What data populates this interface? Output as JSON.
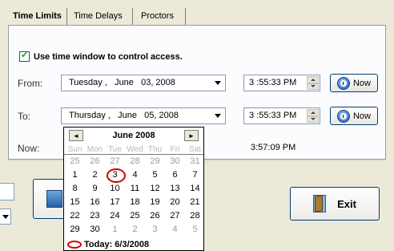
{
  "tabs": [
    "Time Limits",
    "Time Delays",
    "Proctors"
  ],
  "use_time_window": {
    "label": "Use time window to control access.",
    "checked": true
  },
  "from": {
    "label": "From:",
    "date": "Tuesday ,   June   03, 2008",
    "time": "3 :55:33 PM",
    "now_button": "Now"
  },
  "to": {
    "label": "To:",
    "date": "Thursday ,   June   05, 2008",
    "time": "3 :55:33 PM",
    "now_button": "Now"
  },
  "now_row": {
    "label": "Now:",
    "time": "3:57:09 PM"
  },
  "exit_button": "Exit",
  "calendar": {
    "title": "June 2008",
    "prev": "◄",
    "next": "►",
    "weekdays": [
      "Sun",
      "Mon",
      "Tue",
      "Wed",
      "Thu",
      "Fri",
      "Sat"
    ],
    "rows": [
      [
        "25",
        "26",
        "27",
        "28",
        "29",
        "30",
        "31"
      ],
      [
        "1",
        "2",
        "3",
        "4",
        "5",
        "6",
        "7"
      ],
      [
        "8",
        "9",
        "10",
        "11",
        "12",
        "13",
        "14"
      ],
      [
        "15",
        "16",
        "17",
        "18",
        "19",
        "20",
        "21"
      ],
      [
        "22",
        "23",
        "24",
        "25",
        "26",
        "27",
        "28"
      ],
      [
        "29",
        "30",
        "1",
        "2",
        "3",
        "4",
        "5"
      ]
    ],
    "today_label": "Today: 6/3/2008",
    "today_day": "3",
    "selected_day": "5"
  }
}
